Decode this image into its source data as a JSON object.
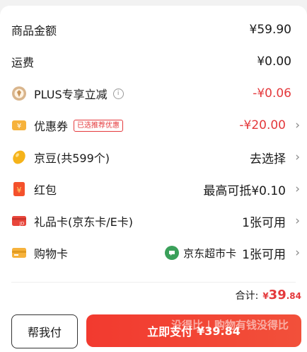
{
  "summary": {
    "goods_amount": {
      "label": "商品金额",
      "value": "¥59.90"
    },
    "shipping": {
      "label": "运费",
      "value": "¥0.00"
    },
    "plus_discount": {
      "label": "PLUS专享立减",
      "value": "-¥0.06",
      "icon": "plus-badge-icon"
    },
    "coupon": {
      "label": "优惠券",
      "tag": "已选推荐优惠",
      "value": "-¥20.00",
      "icon": "coupon-icon"
    },
    "jingdou": {
      "label": "京豆(共599个)",
      "value": "去选择",
      "icon": "bean-icon"
    },
    "red_packet": {
      "label": "红包",
      "value": "最高可抵¥0.10",
      "icon": "red-packet-icon"
    },
    "gift_card": {
      "label": "礼品卡(京东卡/E卡)",
      "value": "1张可用",
      "icon": "gift-card-icon",
      "icon_text": "JD"
    },
    "shopping_card": {
      "label": "购物卡",
      "store": "京东超市卡",
      "value": "1张可用",
      "icon": "shopping-card-icon"
    }
  },
  "total": {
    "label": "合计:",
    "currency": "¥",
    "integer": "39",
    "decimal": ".84"
  },
  "actions": {
    "help_label": "帮我付",
    "pay_label": "立即支付",
    "pay_amount": "¥39.84"
  },
  "watermark": "没得比 | 购物有钱没得比",
  "colors": {
    "accent": "#e4393c",
    "pay_button": "#f23a2f"
  }
}
